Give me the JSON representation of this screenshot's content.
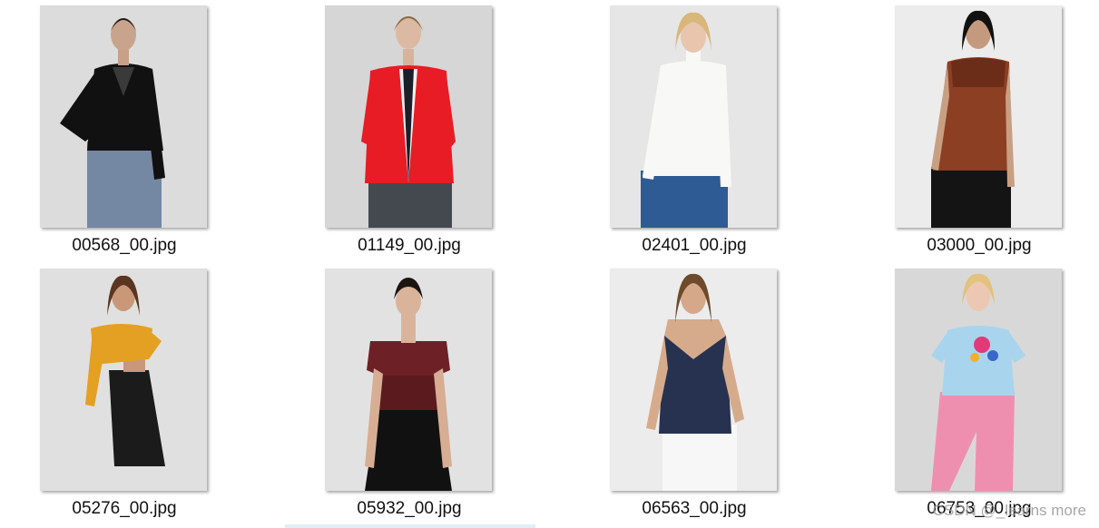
{
  "files": [
    {
      "name": "00568_00.jpg"
    },
    {
      "name": "01149_00.jpg"
    },
    {
      "name": "02401_00.jpg"
    },
    {
      "name": "03000_00.jpg"
    },
    {
      "name": "05276_00.jpg"
    },
    {
      "name": "05932_00.jpg"
    },
    {
      "name": "06563_00.jpg"
    },
    {
      "name": "06753_00.jpg"
    }
  ],
  "watermark": "CSDN @_learns more"
}
